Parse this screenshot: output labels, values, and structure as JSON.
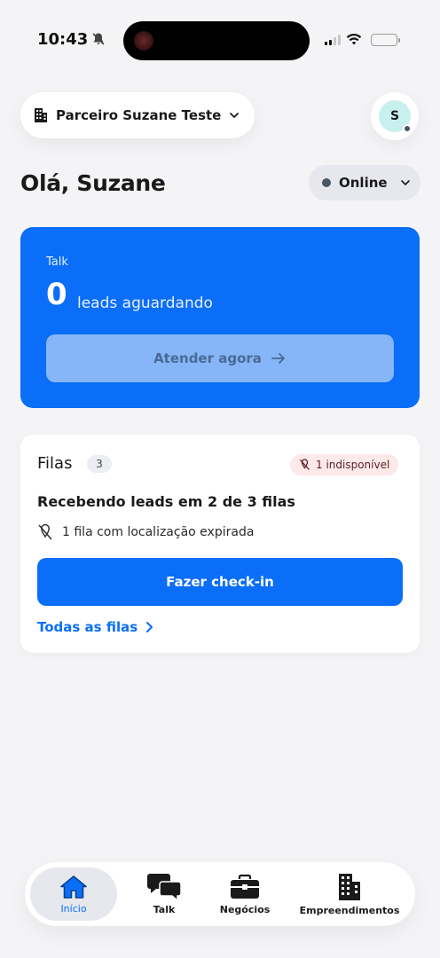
{
  "status_bar": {
    "time": "10:43",
    "icons": [
      "bell-muted-icon",
      "cellular-signal-icon",
      "wifi-icon",
      "battery-icon"
    ]
  },
  "header": {
    "organization": "Parceiro Suzane Teste",
    "avatar_initial": "S"
  },
  "greeting": "Olá, Suzane",
  "presence": {
    "status": "Online"
  },
  "talk_card": {
    "title": "Talk",
    "count": "0",
    "count_label": "leads aguardando",
    "cta": "Atender agora"
  },
  "queues_card": {
    "title": "Filas",
    "count": "3",
    "unavailable_badge": "1 indisponível",
    "receiving": "Recebendo leads em 2 de 3 filas",
    "expired_location": "1 fila com localização expirada",
    "checkin_button": "Fazer check-in",
    "all_queues_link": "Todas as filas"
  },
  "bottom_nav": {
    "items": [
      {
        "label": "Início",
        "icon": "home-icon",
        "active": true
      },
      {
        "label": "Talk",
        "icon": "chat-bubbles-icon",
        "active": false
      },
      {
        "label": "Negócios",
        "icon": "briefcase-icon",
        "active": false
      },
      {
        "label": "Empreendimentos",
        "icon": "building-icon",
        "active": false
      }
    ]
  },
  "colors": {
    "primary": "#0a6ef8",
    "disabled_button": "#86b6f7",
    "background": "#f4f4f6",
    "badge_bg": "#fde9ea",
    "avatar_bg": "#c8f0ee"
  }
}
